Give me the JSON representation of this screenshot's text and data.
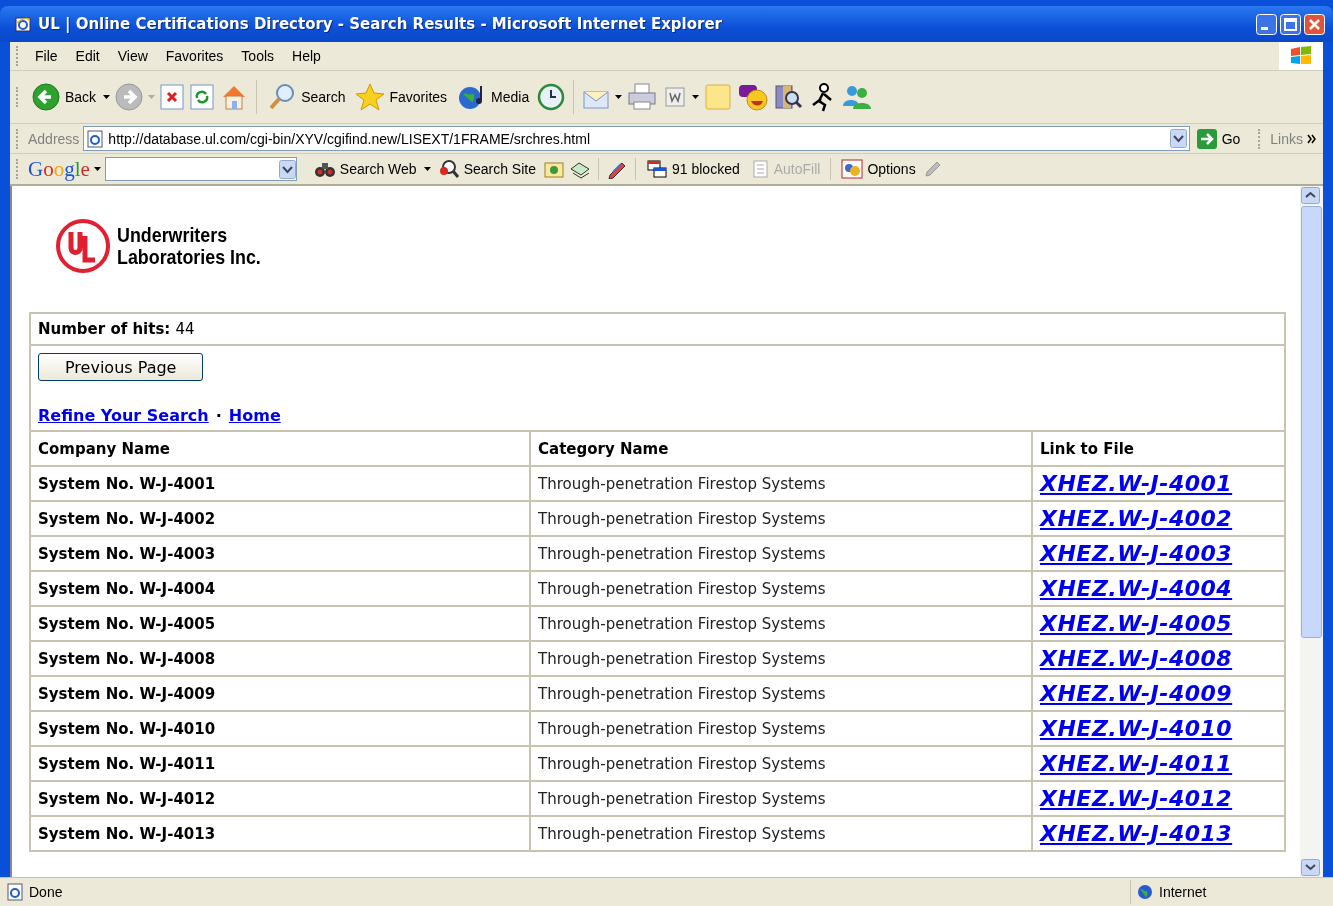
{
  "window": {
    "title": "UL | Online Certifications Directory - Search Results - Microsoft Internet Explorer"
  },
  "menu": [
    "File",
    "Edit",
    "View",
    "Favorites",
    "Tools",
    "Help"
  ],
  "toolbar": {
    "back": "Back",
    "search": "Search",
    "favorites": "Favorites",
    "media": "Media"
  },
  "address": {
    "label": "Address",
    "url": "http://database.ul.com/cgi-bin/XYV/cgifind.new/LISEXT/1FRAME/srchres.html",
    "go": "Go",
    "links": "Links"
  },
  "google_bar": {
    "logo": "Google",
    "search_web": "Search Web",
    "search_site": "Search Site",
    "blocked": "91 blocked",
    "autofill": "AutoFill",
    "autofill_disabled": true,
    "options": "Options"
  },
  "page": {
    "logo_lines": [
      "Underwriters",
      "Laboratories Inc."
    ],
    "hits_label": "Number of hits:",
    "hits": "44",
    "previous_button": "Previous Page",
    "links": [
      "Refine Your Search",
      "Home"
    ],
    "separator": "·"
  },
  "table": {
    "columns": [
      "Company Name",
      "Category Name",
      "Link to File"
    ],
    "rows": [
      [
        "System No. W-J-4001",
        "Through-penetration Firestop Systems",
        "XHEZ.W-J-4001"
      ],
      [
        "System No. W-J-4002",
        "Through-penetration Firestop Systems",
        "XHEZ.W-J-4002"
      ],
      [
        "System No. W-J-4003",
        "Through-penetration Firestop Systems",
        "XHEZ.W-J-4003"
      ],
      [
        "System No. W-J-4004",
        "Through-penetration Firestop Systems",
        "XHEZ.W-J-4004"
      ],
      [
        "System No. W-J-4005",
        "Through-penetration Firestop Systems",
        "XHEZ.W-J-4005"
      ],
      [
        "System No. W-J-4008",
        "Through-penetration Firestop Systems",
        "XHEZ.W-J-4008"
      ],
      [
        "System No. W-J-4009",
        "Through-penetration Firestop Systems",
        "XHEZ.W-J-4009"
      ],
      [
        "System No. W-J-4010",
        "Through-penetration Firestop Systems",
        "XHEZ.W-J-4010"
      ],
      [
        "System No. W-J-4011",
        "Through-penetration Firestop Systems",
        "XHEZ.W-J-4011"
      ],
      [
        "System No. W-J-4012",
        "Through-penetration Firestop Systems",
        "XHEZ.W-J-4012"
      ],
      [
        "System No. W-J-4013",
        "Through-penetration Firestop Systems",
        "XHEZ.W-J-4013"
      ]
    ]
  },
  "status_bar": {
    "text": "Done",
    "zone": "Internet"
  }
}
